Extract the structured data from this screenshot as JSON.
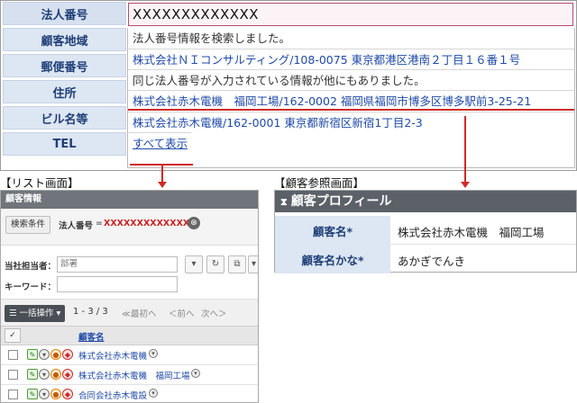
{
  "form": {
    "labels": [
      "法人番号",
      "顧客地域",
      "郵便番号",
      "住所",
      "ビル名等",
      "TEL"
    ],
    "corp_number_value": "XXXXXXXXXXXXX",
    "suggestions": [
      "法人番号情報を検索しました。",
      "株式会社ＮＩコンサルティング/108-0075 東京都港区港南２丁目１６番１号",
      "同じ法人番号が入力されている情報が他にもありました。",
      "株式会社赤木電機　福岡工場/162-0002 福岡県福岡市博多区博多駅前3-25-21",
      "株式会社赤木電機/162-0001 東京都新宿区新宿1丁目2-3",
      "すべて表示"
    ]
  },
  "captions": {
    "list": "【リスト画面】",
    "profile": "【顧客参照画面】"
  },
  "list": {
    "title": "顧客情報",
    "filter_button": "検索条件",
    "filter_label": "法人番号",
    "filter_eq": "=",
    "filter_value": "XXXXXXXXXXXXX",
    "filter_clear_icon": "⊗",
    "owner_label": "当社担当者：",
    "owner_value": "部署",
    "keyword_label": "キーワード：",
    "tool_icons": [
      "▾",
      "↻",
      "⧉",
      "▾"
    ],
    "bulk_button": "☰ 一括操作 ▾",
    "page_count": "1 - 3 / 3",
    "nav_first": "≪最初へ",
    "nav_prev": "＜前へ",
    "nav_next": "次へ＞",
    "head_check": "✓",
    "column_name": "顧客名",
    "rows": [
      {
        "name": "株式会社赤木電機"
      },
      {
        "name": "株式会社赤木電機　福岡工場"
      },
      {
        "name": "合同会社赤木電設"
      }
    ]
  },
  "profile": {
    "title": "顧客プロフィール",
    "title_icon": "⧗",
    "fields": [
      {
        "label": "顧客名*",
        "value": "株式会社赤木電機　福岡工場"
      },
      {
        "label": "顧客名かな*",
        "value": "あかぎでんき"
      }
    ]
  },
  "colors": {
    "label_bg": "#dde6f3",
    "label_text": "#1f3f77",
    "link": "#1f4aa8",
    "highlight": "#cf2a26",
    "header_dark": "#5c6168"
  }
}
